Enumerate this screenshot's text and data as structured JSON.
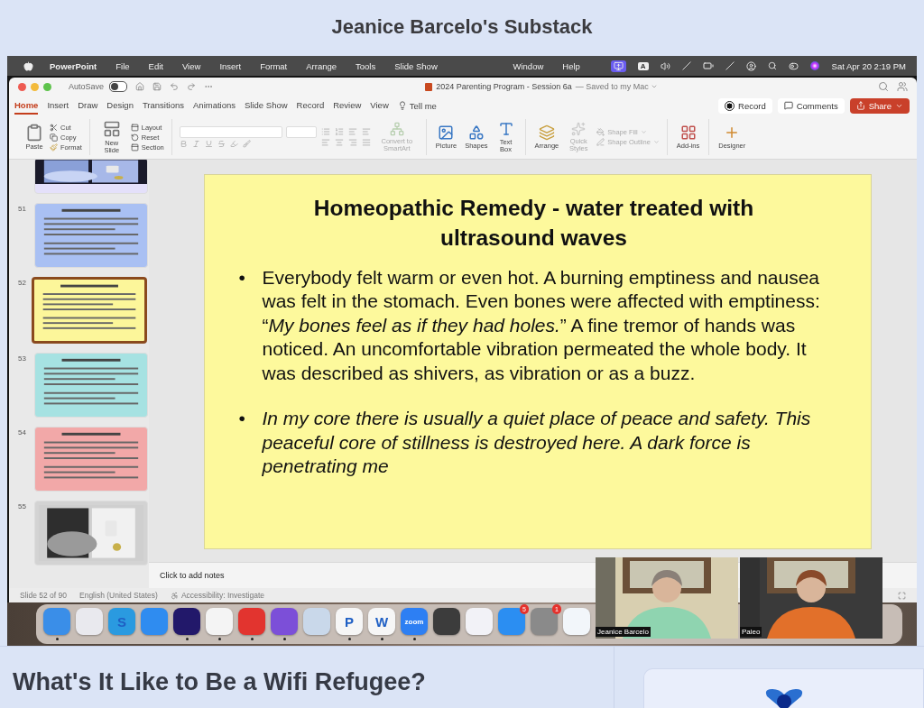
{
  "page_title": "Jeanice Barcelo's Substack",
  "menubar": {
    "app": "PowerPoint",
    "menus": [
      "File",
      "Edit",
      "View",
      "Insert",
      "Format",
      "Arrange",
      "Tools",
      "Slide Show"
    ],
    "right_menus": [
      "Window",
      "Help"
    ],
    "input_source": "A",
    "clock": "Sat Apr 20  2:19 PM"
  },
  "titlebar": {
    "autosave_label": "AutoSave",
    "autosave_on": false,
    "document": "2024 Parenting Program - Session 6a",
    "save_status": "— Saved to my Mac"
  },
  "ribbon_tabs": [
    {
      "label": "Home",
      "selected": true
    },
    {
      "label": "Insert",
      "selected": false
    },
    {
      "label": "Draw",
      "selected": false
    },
    {
      "label": "Design",
      "selected": false
    },
    {
      "label": "Transitions",
      "selected": false
    },
    {
      "label": "Animations",
      "selected": false
    },
    {
      "label": "Slide Show",
      "selected": false
    },
    {
      "label": "Record",
      "selected": false
    },
    {
      "label": "Review",
      "selected": false
    },
    {
      "label": "View",
      "selected": false
    }
  ],
  "tell_me": "Tell me",
  "actions": {
    "record": "Record",
    "comments": "Comments",
    "share": "Share"
  },
  "ribbon": {
    "clipboard": {
      "paste": "Paste",
      "cut": "Cut",
      "copy": "Copy",
      "format": "Format"
    },
    "slides": {
      "new_slide": "New Slide",
      "layout": "Layout",
      "reset": "Reset",
      "section": "Section"
    },
    "smartart": {
      "label": "Convert to SmartArt",
      "disabled": true
    },
    "insert": {
      "picture": "Picture",
      "shapes": "Shapes",
      "text_box": "Text Box"
    },
    "arrange": "Arrange",
    "quick_styles": {
      "label": "Quick Styles",
      "disabled": true
    },
    "shape_fill": {
      "label": "Shape Fill",
      "disabled": true
    },
    "shape_outline": {
      "label": "Shape Outline",
      "disabled": true
    },
    "add_ins": "Add-ins",
    "designer": "Designer"
  },
  "thumbnails": [
    {
      "kind": "picture",
      "color": "#e4e0fa",
      "selected": false
    },
    {
      "number": "51",
      "kind": "text",
      "color": "#a9c0f3",
      "selected": false
    },
    {
      "number": "52",
      "kind": "text",
      "color": "#fcf69a",
      "selected": true
    },
    {
      "number": "53",
      "kind": "text",
      "color": "#a6e2e2",
      "selected": false
    },
    {
      "number": "54",
      "kind": "text",
      "color": "#f2a8a8",
      "selected": false
    },
    {
      "number": "55",
      "kind": "picture",
      "color": "#d3d3d3",
      "selected": false
    }
  ],
  "slide": {
    "title": "Homeopathic Remedy - water treated with ultrasound waves",
    "bullets": [
      {
        "marker": "•",
        "text": "Everybody felt warm or even hot. A burning emptiness and nausea was felt in the stomach. Even bones were affected with emptiness: “*My bones feel as if they had holes.*” A fine tremor of hands was noticed. An uncomfortable vibration permeated the whole body. It was described as shivers, as vibration or as a buzz.",
        "italic": false
      },
      {
        "marker": "•",
        "text": "In my core there is usually a quiet place of peace and safety. This peaceful core of stillness is destroyed here.  A dark force is penetrating me",
        "italic": true
      }
    ]
  },
  "notes_placeholder": "Click to add notes",
  "status_bar": [
    "Slide 52 of 90",
    "English (United States)",
    "Accessibility: Investigate"
  ],
  "dock": [
    {
      "color": "#3a8ee8",
      "running": true
    },
    {
      "color": "#e9e9ee",
      "running": false
    },
    {
      "color": "#2a9ae0",
      "glyph": "S",
      "running": false
    },
    {
      "color": "#2f8cf0",
      "running": false
    },
    {
      "color": "#22186a",
      "running": true
    },
    {
      "color": "#f4f4f4",
      "running": true
    },
    {
      "color": "#e2342f",
      "running": true
    },
    {
      "color": "#7c4fd8",
      "running": true
    },
    {
      "color": "#c9d8ea",
      "running": false
    },
    {
      "color": "#f6f6f6",
      "glyph": "P",
      "running": true
    },
    {
      "color": "#f6f6f6",
      "glyph": "W",
      "running": true
    },
    {
      "color": "#2d7ff3",
      "glyph": "zoom",
      "running": true
    },
    {
      "color": "#3c3c3c",
      "running": false
    },
    {
      "color": "#f2f2f7",
      "running": false
    },
    {
      "color": "#2b8ef2",
      "badge": "5",
      "running": false
    },
    {
      "color": "#8a8a8a",
      "badge": "1",
      "running": false
    },
    {
      "color": "#f2f6fa",
      "running": false
    }
  ],
  "video_tiles": [
    {
      "name": "Jeanice Barcelo"
    },
    {
      "name": "Paleo"
    }
  ],
  "headline": "What's It Like to Be a Wifi Refugee?"
}
